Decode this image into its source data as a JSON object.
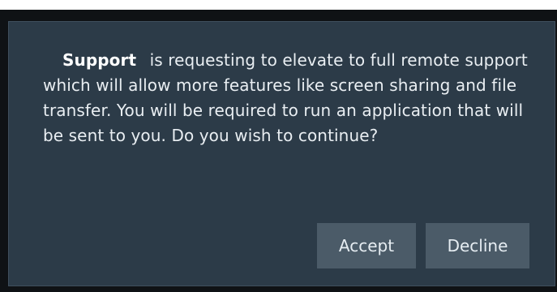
{
  "dialog": {
    "requester_name": "Support",
    "message": "is requesting to elevate to full remote support which will allow more features like screen sharing and file transfer. You will be required to run an application that will be sent to you. Do you wish to continue?",
    "accept_label": "Accept",
    "decline_label": "Decline"
  },
  "colors": {
    "dialog_background": "#2c3b48",
    "button_background": "#4b5b68",
    "text": "#e9eef2",
    "frame": "#0f1215"
  }
}
